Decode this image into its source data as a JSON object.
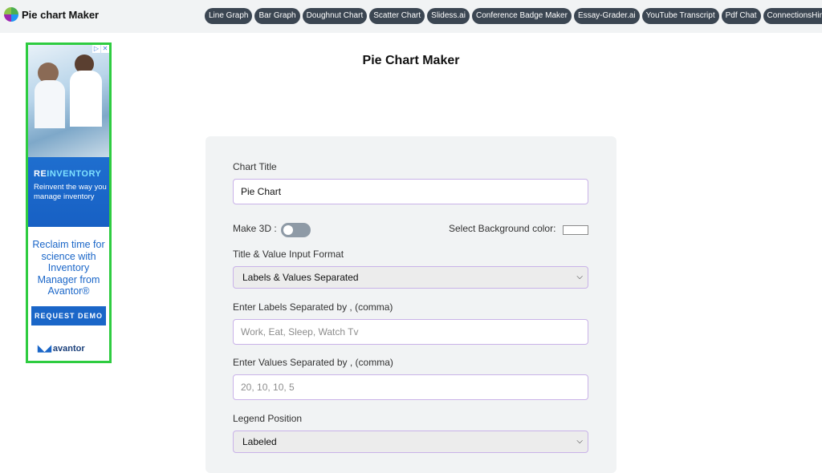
{
  "header": {
    "brand": "Pie chart Maker",
    "nav": [
      "Line Graph",
      "Bar Graph",
      "Doughnut Chart",
      "Scatter Chart",
      "Slidess.ai",
      "Conference Badge Maker",
      "Essay-Grader.ai",
      "YouTube Transcript",
      "Pdf Chat",
      "ConnectionsHint.ai"
    ]
  },
  "ad": {
    "brand_prefix": "RE",
    "brand_highlight": "INVENTORY",
    "tagline": "Reinvent the way you manage inventory",
    "headline": "Reclaim time for science with Inventory Manager from Avantor®",
    "cta": "REQUEST DEMO",
    "logo": "avantor",
    "info_icon": "▷",
    "close_icon": "✕"
  },
  "page": {
    "title": "Pie Chart Maker"
  },
  "form": {
    "chart_title_label": "Chart Title",
    "chart_title_value": "Pie Chart",
    "make3d_label": "Make 3D :",
    "make3d_on": false,
    "bg_color_label": "Select Background color:",
    "bg_color": "#ffffff",
    "input_format_label": "Title & Value Input Format",
    "input_format_value": "Labels & Values Separated",
    "labels_label": "Enter Labels Separated by , (comma)",
    "labels_placeholder": "Work, Eat, Sleep, Watch Tv",
    "values_label": "Enter Values Separated by , (comma)",
    "values_placeholder": "20, 10, 10, 5",
    "legend_label": "Legend Position",
    "legend_value": "Labeled"
  },
  "colors": {
    "nav_pill": "#3b4652",
    "field_border": "#c9b2e8",
    "card_bg": "#f1f3f4",
    "ad_accent": "#1a66c8",
    "ad_border": "#2ecc40"
  }
}
